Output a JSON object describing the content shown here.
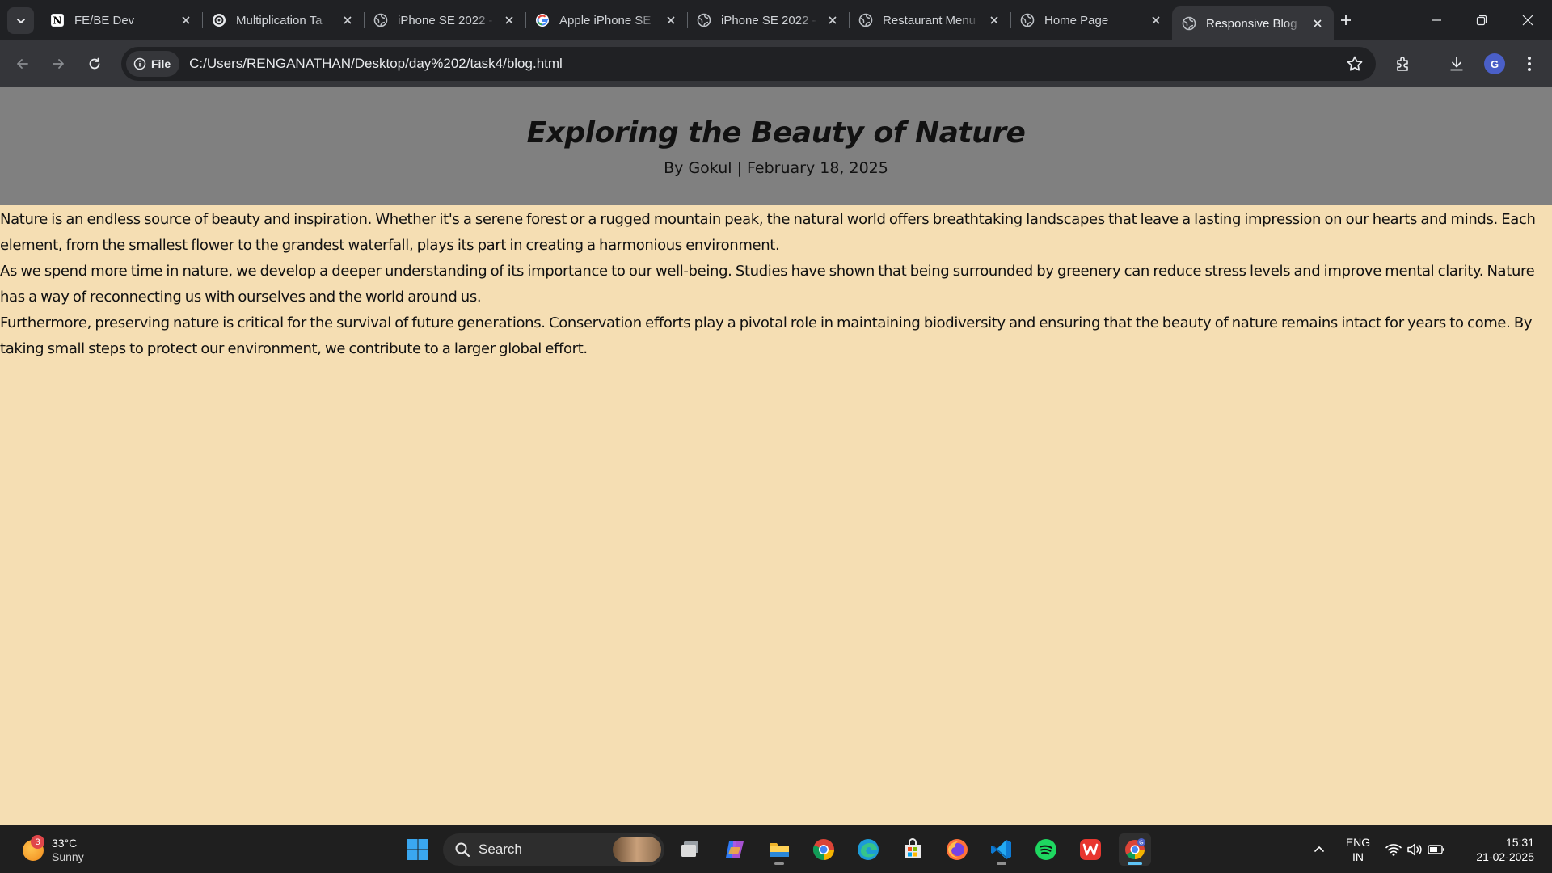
{
  "browser": {
    "tabs": [
      {
        "title": "FE/BE Dev",
        "icon": "notion-icon"
      },
      {
        "title": "Multiplication Ta",
        "icon": "openai-icon"
      },
      {
        "title": "iPhone SE 2022 -",
        "icon": "globe-icon"
      },
      {
        "title": "Apple iPhone SE",
        "icon": "google-icon"
      },
      {
        "title": "iPhone SE 2022 -",
        "icon": "globe-icon"
      },
      {
        "title": "Restaurant Menu",
        "icon": "globe-icon"
      },
      {
        "title": "Home Page",
        "icon": "globe-icon"
      },
      {
        "title": "Responsive Blog",
        "icon": "globe-icon",
        "active": true
      }
    ],
    "address": {
      "chip_label": "File",
      "url": "C:/Users/RENGANATHAN/Desktop/day%202/task4/blog.html"
    },
    "profile_initial": "G"
  },
  "page": {
    "title": "Exploring the Beauty of Nature",
    "meta": "By Gokul | February 18, 2025",
    "paragraphs": [
      "Nature is an endless source of beauty and inspiration. Whether it's a serene forest or a rugged mountain peak, the natural world offers breathtaking landscapes that leave a lasting impression on our hearts and minds. Each element, from the smallest flower to the grandest waterfall, plays its part in creating a harmonious environment.",
      "As we spend more time in nature, we develop a deeper understanding of its importance to our well-being. Studies have shown that being surrounded by greenery can reduce stress levels and improve mental clarity. Nature has a way of reconnecting us with ourselves and the world around us.",
      "Furthermore, preserving nature is critical for the survival of future generations. Conservation efforts play a pivotal role in maintaining biodiversity and ensuring that the beauty of nature remains intact for years to come. By taking small steps to protect our environment, we contribute to a larger global effort."
    ],
    "colors": {
      "header_bg": "#808080",
      "body_bg": "#f5deb3"
    }
  },
  "taskbar": {
    "weather": {
      "temp": "33°C",
      "condition": "Sunny",
      "badge": "3"
    },
    "search_label": "Search",
    "apps": [
      "windows-start-icon",
      "task-view-icon",
      "copilot-icon",
      "file-explorer-icon",
      "chrome-icon",
      "edge-icon",
      "microsoft-store-icon",
      "firefox-icon",
      "vscode-icon",
      "spotify-icon",
      "wps-office-icon",
      "chrome-profile-icon"
    ],
    "language": {
      "line1": "ENG",
      "line2": "IN"
    },
    "clock": {
      "time": "15:31",
      "date": "21-02-2025"
    }
  }
}
